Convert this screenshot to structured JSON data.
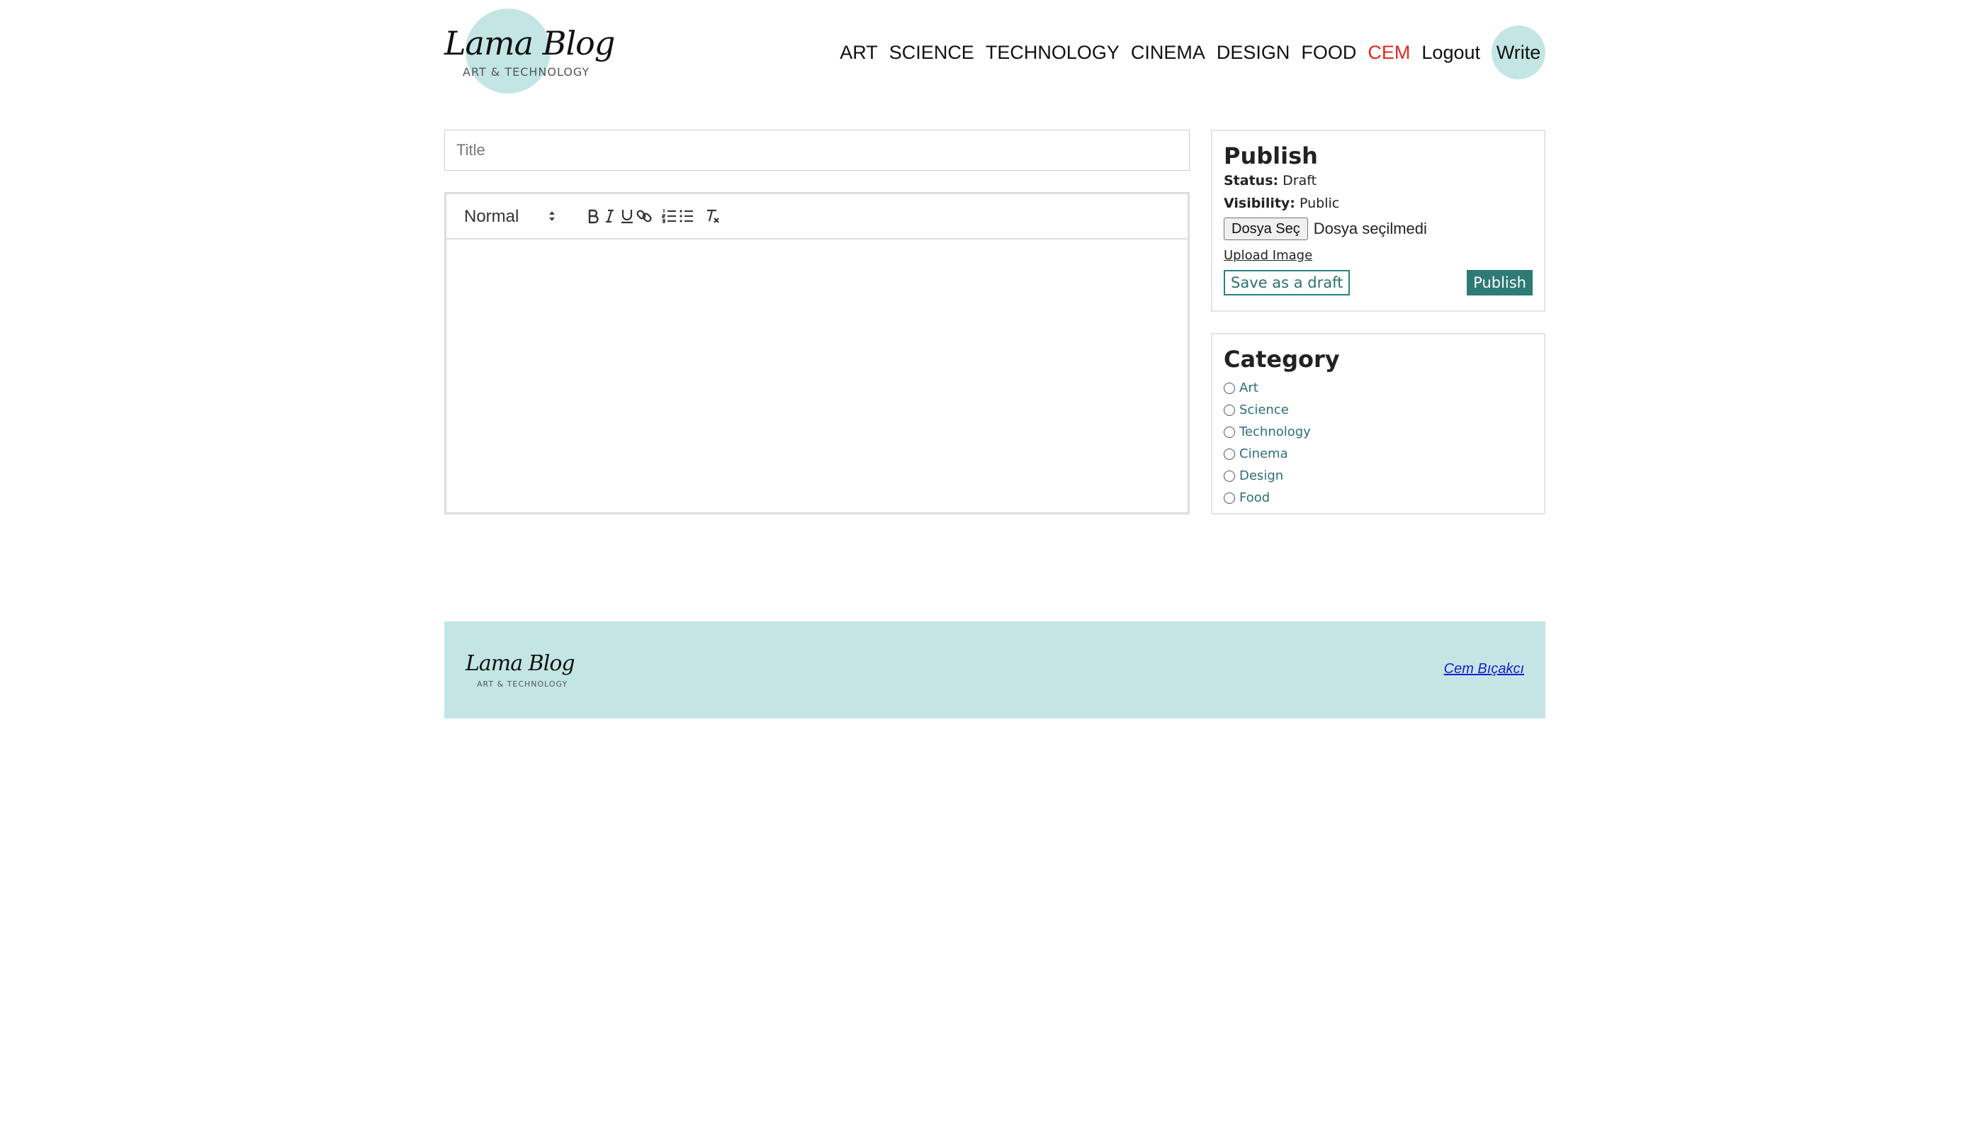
{
  "brand": {
    "name": "Lama Blog",
    "tagline": "ART & TECHNOLOGY"
  },
  "nav": {
    "links": [
      "ART",
      "SCIENCE",
      "TECHNOLOGY",
      "CINEMA",
      "DESIGN",
      "FOOD"
    ],
    "user": "CEM",
    "logout": "Logout",
    "write": "Write"
  },
  "editor": {
    "title_placeholder": "Title",
    "title_value": "",
    "toolbar": {
      "heading_select": "Normal",
      "buttons": [
        "bold-icon",
        "italic-icon",
        "underline-icon",
        "link-icon",
        "ordered-list-icon",
        "bullet-list-icon",
        "clear-format-icon"
      ]
    },
    "body": ""
  },
  "publish": {
    "title": "Publish",
    "status_label": "Status:",
    "status_value": "Draft",
    "visibility_label": "Visibility:",
    "visibility_value": "Public",
    "file_button": "Dosya Seç",
    "file_status": "Dosya seçilmedi",
    "upload_link": "Upload Image",
    "draft_button": "Save as a draft",
    "publish_button": "Publish"
  },
  "category": {
    "title": "Category",
    "options": [
      "Art",
      "Science",
      "Technology",
      "Cinema",
      "Design",
      "Food"
    ],
    "selected": null
  },
  "footer": {
    "brand_name": "Lama Blog",
    "brand_tagline": "ART & TECHNOLOGY",
    "author": "Cem Bıçakcı"
  },
  "colors": {
    "accent": "#c3e6e5",
    "primary_button": "#2f7a74",
    "user_highlight": "#e0291f",
    "category_text": "#2d6f78"
  }
}
